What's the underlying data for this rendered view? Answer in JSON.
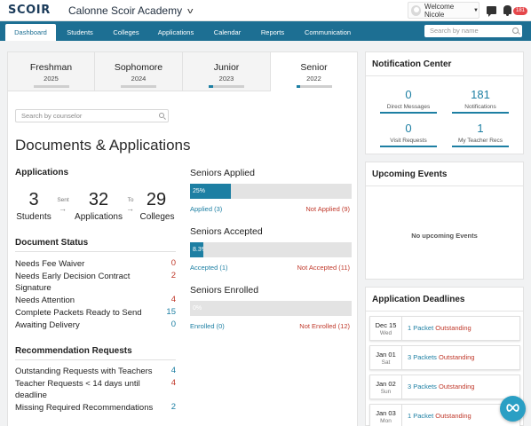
{
  "app": {
    "logo": "SCOIR",
    "school": "Calonne Scoir Academy",
    "welcome": "Welcome Nicole",
    "notif_badge": "181"
  },
  "nav": {
    "tabs": [
      "Dashboard",
      "Students",
      "Colleges",
      "Applications",
      "Calendar",
      "Reports",
      "Communication"
    ],
    "active": "Dashboard",
    "search_placeholder": "Search by name"
  },
  "grades": [
    {
      "name": "Freshman",
      "year": "2025",
      "progress": 0
    },
    {
      "name": "Sophomore",
      "year": "2024",
      "progress": 0
    },
    {
      "name": "Junior",
      "year": "2023",
      "progress": 0.12
    },
    {
      "name": "Senior",
      "year": "2022",
      "progress": 0.12
    }
  ],
  "counselor_placeholder": "Search by counselor",
  "page_title": "Documents & Applications",
  "applications": {
    "heading": "Applications",
    "students": "3",
    "students_label": "Students",
    "sent_label": "Sent",
    "applications": "32",
    "applications_label": "Applications",
    "to_label": "To",
    "colleges": "29",
    "colleges_label": "Colleges"
  },
  "document_status": {
    "heading": "Document Status",
    "rows": [
      {
        "label": "Needs Fee Waiver",
        "value": "0"
      },
      {
        "label": "Needs Early Decision Contract Signature",
        "value": "2"
      },
      {
        "label": "Needs Attention",
        "value": "4"
      },
      {
        "label": "Complete Packets Ready to Send",
        "value": "15"
      },
      {
        "label": "Awaiting Delivery",
        "value": "0"
      }
    ]
  },
  "recommendations": {
    "heading": "Recommendation Requests",
    "rows": [
      {
        "label": "Outstanding Requests with Teachers",
        "value": "4"
      },
      {
        "label": "Teacher Requests < 14 days until deadline",
        "value": "4"
      },
      {
        "label": "Missing Required Recommendations",
        "value": "2"
      }
    ]
  },
  "seniors": {
    "applied": {
      "title": "Seniors Applied",
      "percent": 25,
      "percent_label": "25%",
      "left": "Applied (3)",
      "right": "Not Applied (9)"
    },
    "accepted": {
      "title": "Seniors Accepted",
      "percent": 8.3,
      "percent_label": "8.3%",
      "left": "Accepted (1)",
      "right": "Not Accepted (11)"
    },
    "enrolled": {
      "title": "Seniors Enrolled",
      "percent": 0,
      "percent_label": "0%",
      "left": "Enrolled (0)",
      "right": "Not Enrolled (12)"
    }
  },
  "notification_center": {
    "title": "Notification Center",
    "items": [
      {
        "value": "0",
        "label": "Direct Messages"
      },
      {
        "value": "181",
        "label": "Notifications"
      },
      {
        "value": "0",
        "label": "Visit Requests"
      },
      {
        "value": "1",
        "label": "My Teacher Recs"
      }
    ]
  },
  "upcoming_events": {
    "title": "Upcoming Events",
    "empty": "No upcoming Events"
  },
  "deadlines": {
    "title": "Application Deadlines",
    "items": [
      {
        "date": "Dec 15",
        "day": "Wed",
        "count_text": "1 Packet",
        "status": "Outstanding"
      },
      {
        "date": "Jan 01",
        "day": "Sat",
        "count_text": "3 Packets",
        "status": "Outstanding"
      },
      {
        "date": "Jan 02",
        "day": "Sun",
        "count_text": "3 Packets",
        "status": "Outstanding"
      },
      {
        "date": "Jan 03",
        "day": "Mon",
        "count_text": "1 Packet",
        "status": "Outstanding"
      }
    ]
  },
  "colors": {
    "brand": "#1d6f93",
    "accent": "#1d7fa3",
    "alert": "#c0392b",
    "badge": "#e5474b"
  }
}
